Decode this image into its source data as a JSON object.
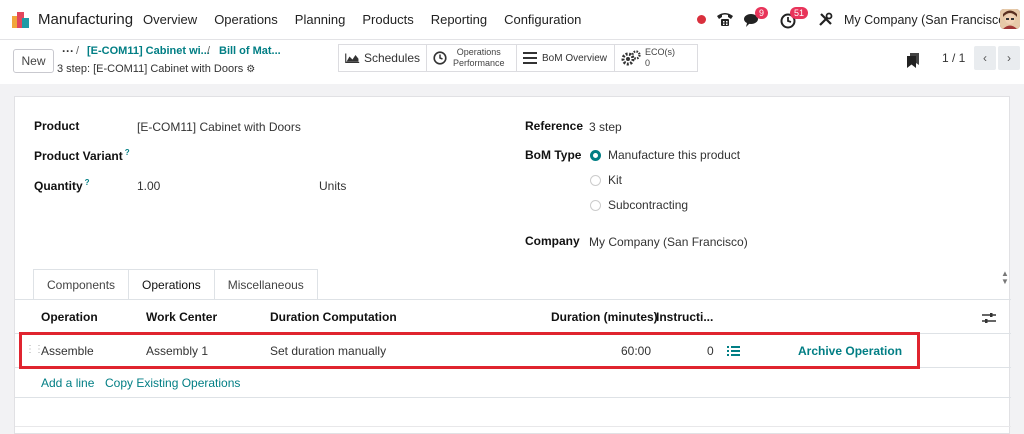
{
  "navbar": {
    "app_name": "Manufacturing",
    "menu": [
      "Overview",
      "Operations",
      "Planning",
      "Products",
      "Reporting",
      "Configuration"
    ],
    "phone_badge": "",
    "messages_badge": "9",
    "activities_badge": "51",
    "company": "My Company (San Francisco)"
  },
  "control_panel": {
    "new_label": "New",
    "breadcrumb": [
      "[E-COM11] Cabinet wi...",
      "Bill of Mat..."
    ],
    "record_title": "3 step: [E-COM11] Cabinet with Doors",
    "smart_buttons": {
      "schedules": "Schedules",
      "operations_performance": [
        "Operations",
        "Performance"
      ],
      "bom_overview": "BoM Overview",
      "ecos_label": "ECO(s)",
      "ecos_count": "0"
    },
    "pager": "1 / 1"
  },
  "form": {
    "product_label": "Product",
    "product_value": "[E-COM11] Cabinet with Doors",
    "variant_label": "Product Variant",
    "quantity_label": "Quantity",
    "quantity_value": "1.00",
    "quantity_uom": "Units",
    "reference_label": "Reference",
    "reference_value": "3 step",
    "bom_type_label": "BoM Type",
    "bom_type_options": [
      "Manufacture this product",
      "Kit",
      "Subcontracting"
    ],
    "bom_type_selected": "Manufacture this product",
    "company_label": "Company",
    "company_value": "My Company (San Francisco)",
    "help_mark": "?"
  },
  "tabs": [
    "Components",
    "Operations",
    "Miscellaneous"
  ],
  "active_tab": "Operations",
  "operations_table": {
    "headers": [
      "Operation",
      "Work Center",
      "Duration Computation",
      "Duration (minutes)",
      "Instructi..."
    ],
    "rows": [
      {
        "operation": "Assemble",
        "work_center": "Assembly 1",
        "duration_computation": "Set duration manually",
        "duration": "60:00",
        "instructions": "0",
        "action": "Archive Operation"
      }
    ],
    "add_line": "Add a line",
    "copy_existing": "Copy Existing Operations"
  },
  "colors": {
    "accent": "#017e84",
    "highlight": "#e0242f",
    "badge": "#e8345a"
  }
}
